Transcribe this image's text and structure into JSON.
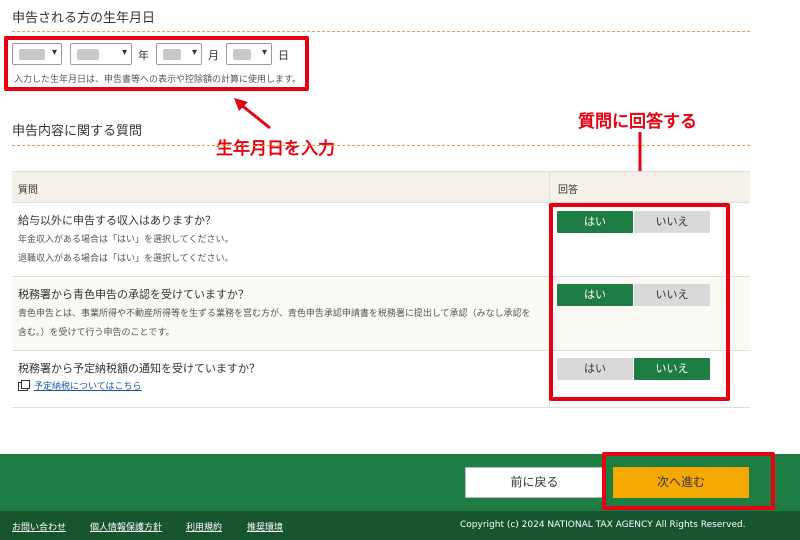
{
  "birth": {
    "title": "申告される方の生年月日",
    "year_unit": "年",
    "month_unit": "月",
    "day_unit": "日",
    "note": "入力した生年月日は、申告書等への表示や控除額の計算に使用します。"
  },
  "questions_section": {
    "title": "申告内容に関する質問",
    "col_question": "質問",
    "col_answer": "回答",
    "rows": [
      {
        "question": "給与以外に申告する収入はありますか？",
        "sub1": "年金収入がある場合は「はい」を選択してください。",
        "sub2": "退職収入がある場合は「はい」を選択してください。",
        "yes": "はい",
        "no": "いいえ"
      },
      {
        "question": "税務署から青色申告の承認を受けていますか？",
        "sub1": "青色申告とは、事業所得や不動産所得等を生ずる業務を営む方が、青色申告承認申請書を税務署に提出して承認（みなし承認を",
        "sub2": "含む。）を受けて行う申告のことです。",
        "yes": "はい",
        "no": "いいえ"
      },
      {
        "question": "税務署から予定納税額の通知を受けていますか？",
        "link": "予定納税についてはこちら",
        "yes": "はい",
        "no": "いいえ"
      }
    ]
  },
  "annotations": {
    "birth_input": "生年月日を入力",
    "answer_questions": "質問に回答する"
  },
  "footer": {
    "back": "前に戻る",
    "next": "次へ進む",
    "links": [
      "お問い合わせ",
      "個人情報保護方針",
      "利用規約",
      "推奨環境"
    ],
    "copyright": "Copyright (c) 2024 NATIONAL TAX AGENCY All Rights Reserved."
  },
  "colors": {
    "green": "#1e7d43",
    "dark_green": "#16552e",
    "orange": "#f5a800",
    "annotation_red": "#e60012"
  },
  "icons": [
    "chevron-down-icon",
    "external-window-icon",
    "arrow-icon"
  ]
}
